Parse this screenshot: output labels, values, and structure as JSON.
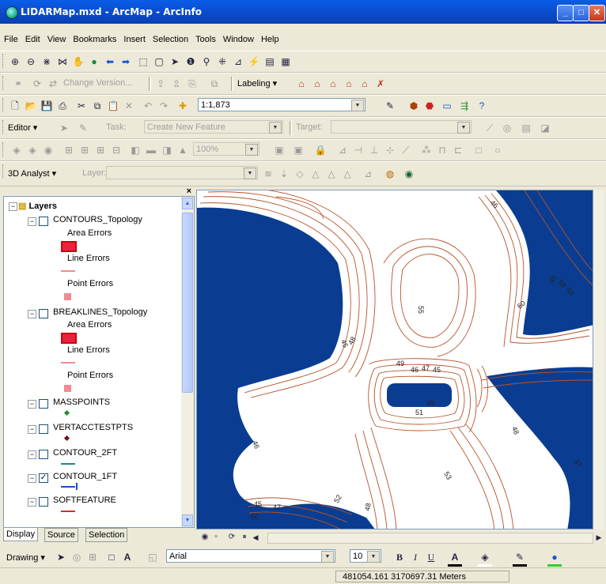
{
  "window": {
    "title": "LIDARMap.mxd - ArcMap - ArcInfo"
  },
  "menu": [
    "File",
    "Edit",
    "View",
    "Bookmarks",
    "Insert",
    "Selection",
    "Tools",
    "Window",
    "Help"
  ],
  "versioning_toolbar": {
    "change_version_label": "Change Version...",
    "labeling_label": "Labeling ▾"
  },
  "standard_toolbar": {
    "scale_value": "1:1,873"
  },
  "editor_toolbar": {
    "editor_label": "Editor ▾",
    "task_label": "Task:",
    "task_value": "Create New Feature",
    "target_label": "Target:"
  },
  "analyst_toolbar": {
    "label": "3D Analyst ▾",
    "layer_label": "Layer:"
  },
  "toc": {
    "root": "Layers",
    "layers": [
      {
        "name": "CONTOURS_Topology",
        "checked": false,
        "legend": [
          "Area Errors",
          "Line Errors",
          "Point Errors"
        ]
      },
      {
        "name": "BREAKLINES_Topology",
        "checked": false,
        "legend": [
          "Area Errors",
          "Line Errors",
          "Point Errors"
        ]
      },
      {
        "name": "MASSPOINTS",
        "checked": false
      },
      {
        "name": "VERTACCTESTPTS",
        "checked": false
      },
      {
        "name": "CONTOUR_2FT",
        "checked": false
      },
      {
        "name": "CONTOUR_1FT",
        "checked": true
      },
      {
        "name": "SOFTFEATURE",
        "checked": false
      }
    ],
    "tabs": [
      "Display",
      "Source",
      "Selection"
    ]
  },
  "map": {
    "colors": {
      "water": "#0a3d91",
      "contour": "#b5532a",
      "land": "#ffffff"
    },
    "contour_labels": [
      "46",
      "45",
      "60",
      "55",
      "45",
      "48",
      "49",
      "46",
      "47",
      "45",
      "49",
      "51",
      "48",
      "46",
      "45",
      "47",
      "50",
      "52",
      "48",
      "53",
      "47",
      "58",
      "63"
    ]
  },
  "drawing_toolbar": {
    "drawing_label": "Drawing ▾",
    "font_name": "Arial",
    "font_size": "10"
  },
  "status": {
    "coordinates": "481054.161  3170697.31 Meters"
  }
}
